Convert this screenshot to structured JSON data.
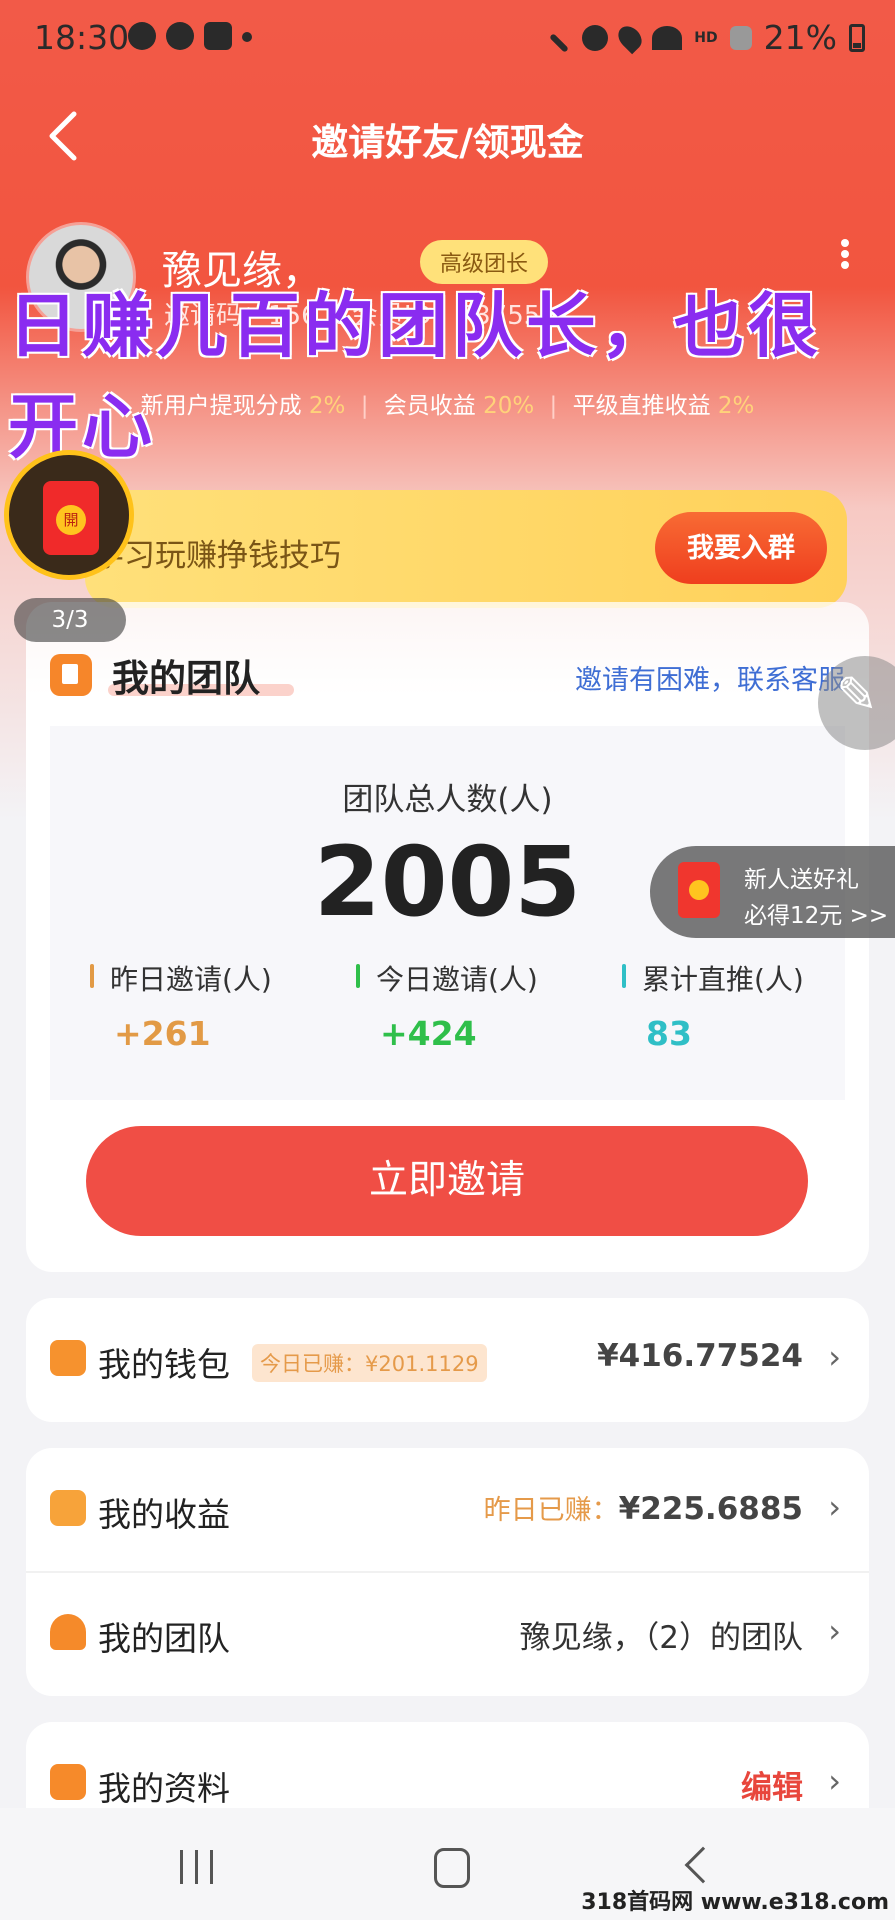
{
  "status_bar": {
    "time": "18:30",
    "network": "HD",
    "battery": "21%"
  },
  "header": {
    "title": "邀请好友/领现金"
  },
  "profile": {
    "name": "豫见缘，",
    "level": "高级团长",
    "meta": "邀请码：156… 会员ID：73755…"
  },
  "watermark": "日赚几百的团队长，也很开心",
  "commission": {
    "items": [
      {
        "label": "新用户提现分成",
        "value": "2%"
      },
      {
        "label": "会员收益",
        "value": "20%"
      },
      {
        "label": "平级直推收益",
        "value": "2%"
      }
    ],
    "separator": "|"
  },
  "banner": {
    "text": "学习玩赚挣钱技巧",
    "button": "我要入群"
  },
  "float": {
    "page_counter": "3/3",
    "redpacket_char": "開"
  },
  "team": {
    "title": "我的团队",
    "help_link": "邀请有困难，联系客服",
    "total_label": "团队总人数(人)",
    "total_value": "2005",
    "stats": [
      {
        "label": "昨日邀请(人)",
        "value": "+261",
        "color": "#e29a45"
      },
      {
        "label": "今日邀请(人)",
        "value": "+424",
        "color": "#2fbf4a"
      },
      {
        "label": "累计直推(人)",
        "value": "83",
        "color": "#2fbfc6"
      }
    ],
    "invite_button": "立即邀请"
  },
  "newbie": {
    "line1": "新人送好礼",
    "line2": "必得12元 >>"
  },
  "wallet": {
    "title": "我的钱包",
    "today_chip": "今日已赚：¥201.1129",
    "amount": "¥416.77524"
  },
  "earnings": {
    "title": "我的收益",
    "yesterday_label": "昨日已赚：",
    "yesterday_amount": "¥225.6885"
  },
  "my_team_row": {
    "title": "我的团队",
    "value": "豫见缘，（2）的团队"
  },
  "profile_row": {
    "title": "我的资料",
    "action": "编辑"
  },
  "site_mark": "318首码网 www.e318.com",
  "colors": {
    "primary_red": "#f04e45",
    "banner_yellow": "#ffd15a",
    "link_blue": "#3f6ed4"
  }
}
